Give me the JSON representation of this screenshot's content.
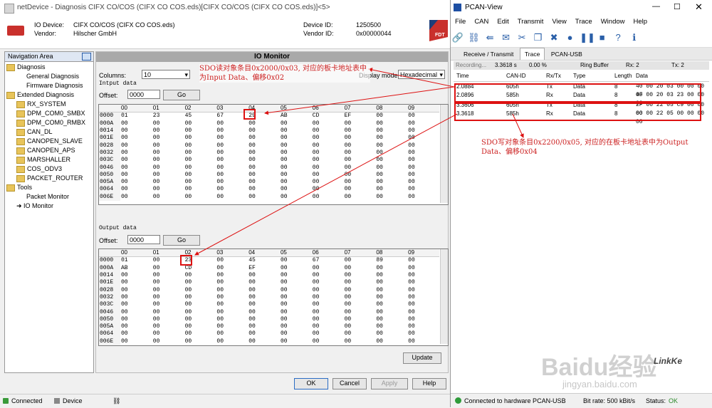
{
  "left_window": {
    "title": "netDevice - Diagnosis CIFX CO/COS (CIFX CO COS.eds)[CIFX CO/COS (CIFX CO COS.eds)]<5>",
    "device": {
      "io_device_label": "IO Device:",
      "io_device_value": "CIFX CO/COS (CIFX CO COS.eds)",
      "vendor_label": "Vendor:",
      "vendor_value": "Hilscher GmbH",
      "device_id_label": "Device ID:",
      "device_id_value": "1250500",
      "vendor_id_label": "Vendor ID:",
      "vendor_id_value": "0x00000044",
      "logo": "FDT"
    },
    "nav": {
      "title": "Navigation Area",
      "items": [
        {
          "label": "Diagnosis",
          "level": 0,
          "icon": "folder-icon"
        },
        {
          "label": "General Diagnosis",
          "level": 1,
          "icon": ""
        },
        {
          "label": "Firmware Diagnosis",
          "level": 1,
          "icon": ""
        },
        {
          "label": "Extended Diagnosis",
          "level": 0,
          "icon": "folder-icon"
        },
        {
          "label": "RX_SYSTEM",
          "level": 1,
          "icon": "folder-icon"
        },
        {
          "label": "DPM_COM0_SMBX",
          "level": 1,
          "icon": "folder-icon"
        },
        {
          "label": "DPM_COM0_RMBX",
          "level": 1,
          "icon": "folder-icon"
        },
        {
          "label": "CAN_DL",
          "level": 1,
          "icon": "folder-icon"
        },
        {
          "label": "CANOPEN_SLAVE",
          "level": 1,
          "icon": "folder-icon"
        },
        {
          "label": "CANOPEN_APS",
          "level": 1,
          "icon": "folder-icon"
        },
        {
          "label": "MARSHALLER",
          "level": 1,
          "icon": "folder-icon"
        },
        {
          "label": "COS_ODV3",
          "level": 1,
          "icon": "folder-icon"
        },
        {
          "label": "PACKET_ROUTER",
          "level": 1,
          "icon": "folder-icon"
        },
        {
          "label": "Tools",
          "level": 0,
          "icon": "folder-icon"
        },
        {
          "label": "Packet Monitor",
          "level": 1,
          "icon": ""
        },
        {
          "label": "IO Monitor",
          "level": 1,
          "icon": "arrow-icon"
        }
      ]
    },
    "io_monitor": {
      "title": "IO Monitor",
      "columns_label": "Columns:",
      "columns_value": "10",
      "display_mode_label": "Display mode:",
      "display_mode_value": "Hexadecimal",
      "input_section": "Intput data",
      "input_offset_label": "Offset:",
      "input_offset_value": "0000",
      "go_label": "Go",
      "output_section": "Output data",
      "output_offset_label": "Offset:",
      "output_offset_value": "0000",
      "col_headers": [
        "00",
        "01",
        "02",
        "03",
        "04",
        "05",
        "06",
        "07",
        "08",
        "09"
      ],
      "input_rows": [
        [
          "0000",
          "01",
          "23",
          "45",
          "67",
          "29",
          "AB",
          "CD",
          "EF",
          "00",
          "00"
        ],
        [
          "000A",
          "00",
          "00",
          "00",
          "00",
          "00",
          "00",
          "00",
          "00",
          "00",
          "00"
        ],
        [
          "0014",
          "00",
          "00",
          "00",
          "00",
          "00",
          "00",
          "00",
          "00",
          "00",
          "00"
        ],
        [
          "001E",
          "00",
          "00",
          "00",
          "00",
          "00",
          "00",
          "00",
          "00",
          "00",
          "00"
        ],
        [
          "0028",
          "00",
          "00",
          "00",
          "00",
          "00",
          "00",
          "00",
          "00",
          "00",
          "00"
        ],
        [
          "0032",
          "00",
          "00",
          "00",
          "00",
          "00",
          "00",
          "00",
          "00",
          "00",
          "00"
        ],
        [
          "003C",
          "00",
          "00",
          "00",
          "00",
          "00",
          "00",
          "00",
          "00",
          "00",
          "00"
        ],
        [
          "0046",
          "00",
          "00",
          "00",
          "00",
          "00",
          "00",
          "00",
          "00",
          "00",
          "00"
        ],
        [
          "0050",
          "00",
          "00",
          "00",
          "00",
          "00",
          "00",
          "00",
          "00",
          "00",
          "00"
        ],
        [
          "005A",
          "00",
          "00",
          "00",
          "00",
          "00",
          "00",
          "00",
          "00",
          "00",
          "00"
        ],
        [
          "0064",
          "00",
          "00",
          "00",
          "00",
          "00",
          "00",
          "00",
          "00",
          "00",
          "00"
        ],
        [
          "006E",
          "00",
          "00",
          "00",
          "00",
          "00",
          "00",
          "00",
          "00",
          "00",
          "00"
        ]
      ],
      "output_rows": [
        [
          "0000",
          "01",
          "00",
          "23",
          "00",
          "45",
          "00",
          "67",
          "00",
          "89",
          "00"
        ],
        [
          "000A",
          "AB",
          "00",
          "CD",
          "00",
          "EF",
          "00",
          "00",
          "00",
          "00",
          "00"
        ],
        [
          "0014",
          "00",
          "00",
          "00",
          "00",
          "00",
          "00",
          "00",
          "00",
          "00",
          "00"
        ],
        [
          "001E",
          "00",
          "00",
          "00",
          "00",
          "00",
          "00",
          "00",
          "00",
          "00",
          "00"
        ],
        [
          "0028",
          "00",
          "00",
          "00",
          "00",
          "00",
          "00",
          "00",
          "00",
          "00",
          "00"
        ],
        [
          "0032",
          "00",
          "00",
          "00",
          "00",
          "00",
          "00",
          "00",
          "00",
          "00",
          "00"
        ],
        [
          "003C",
          "00",
          "00",
          "00",
          "00",
          "00",
          "00",
          "00",
          "00",
          "00",
          "00"
        ],
        [
          "0046",
          "00",
          "00",
          "00",
          "00",
          "00",
          "00",
          "00",
          "00",
          "00",
          "00"
        ],
        [
          "0050",
          "00",
          "00",
          "00",
          "00",
          "00",
          "00",
          "00",
          "00",
          "00",
          "00"
        ],
        [
          "005A",
          "00",
          "00",
          "00",
          "00",
          "00",
          "00",
          "00",
          "00",
          "00",
          "00"
        ],
        [
          "0064",
          "00",
          "00",
          "00",
          "00",
          "00",
          "00",
          "00",
          "00",
          "00",
          "00"
        ],
        [
          "006E",
          "00",
          "00",
          "00",
          "00",
          "00",
          "00",
          "00",
          "00",
          "00",
          "00"
        ]
      ],
      "update_label": "Update"
    },
    "buttons": {
      "ok": "OK",
      "cancel": "Cancel",
      "apply": "Apply",
      "help": "Help"
    },
    "status": {
      "connected": "Connected",
      "device": "Device"
    }
  },
  "right_window": {
    "title": "PCAN-View",
    "menu": [
      "File",
      "CAN",
      "Edit",
      "Transmit",
      "View",
      "Trace",
      "Window",
      "Help"
    ],
    "tabs": [
      "Receive / Transmit",
      "Trace",
      "PCAN-USB"
    ],
    "rec": {
      "label": "Recording...",
      "time": "3.3618 s",
      "pct": "0.00 %",
      "buffer": "Ring Buffer",
      "rx": "Rx: 2",
      "tx": "Tx: 2"
    },
    "trace_headers": [
      "Time",
      "CAN-ID",
      "Rx/Tx",
      "Type",
      "Length",
      "Data"
    ],
    "trace_rows": [
      [
        "2.0884",
        "605h",
        "Tx",
        "Data",
        "8",
        "40 00 20 03 00 00 00 00"
      ],
      [
        "2.0896",
        "585h",
        "Rx",
        "Data",
        "8",
        "4F 00 20 03 23 00 00 00"
      ],
      [
        "3.3606",
        "605h",
        "Tx",
        "Data",
        "8",
        "2F 00 22 05 C9 00 00 00"
      ],
      [
        "3.3618",
        "585h",
        "Rx",
        "Data",
        "8",
        "60 00 22 05 00 00 00 00"
      ]
    ],
    "status": {
      "connected": "Connected to hardware PCAN-USB",
      "bitrate": "Bit rate: 500 kBit/s",
      "status": "Status:",
      "ok": "OK"
    }
  },
  "annotations": {
    "sdo_read": "SDO读对象条目0x2000/0x03, 对应的板卡地址表中为Input Data、偏移0x02",
    "sdo_write": "SDO写对象条目0x2200/0x05, 对应的在板卡地址表中为Output Data、偏移0x04"
  },
  "watermark": {
    "text1": "Baidu经验",
    "text2": "jingyan.baidu.com",
    "text3": "LinkKe"
  }
}
